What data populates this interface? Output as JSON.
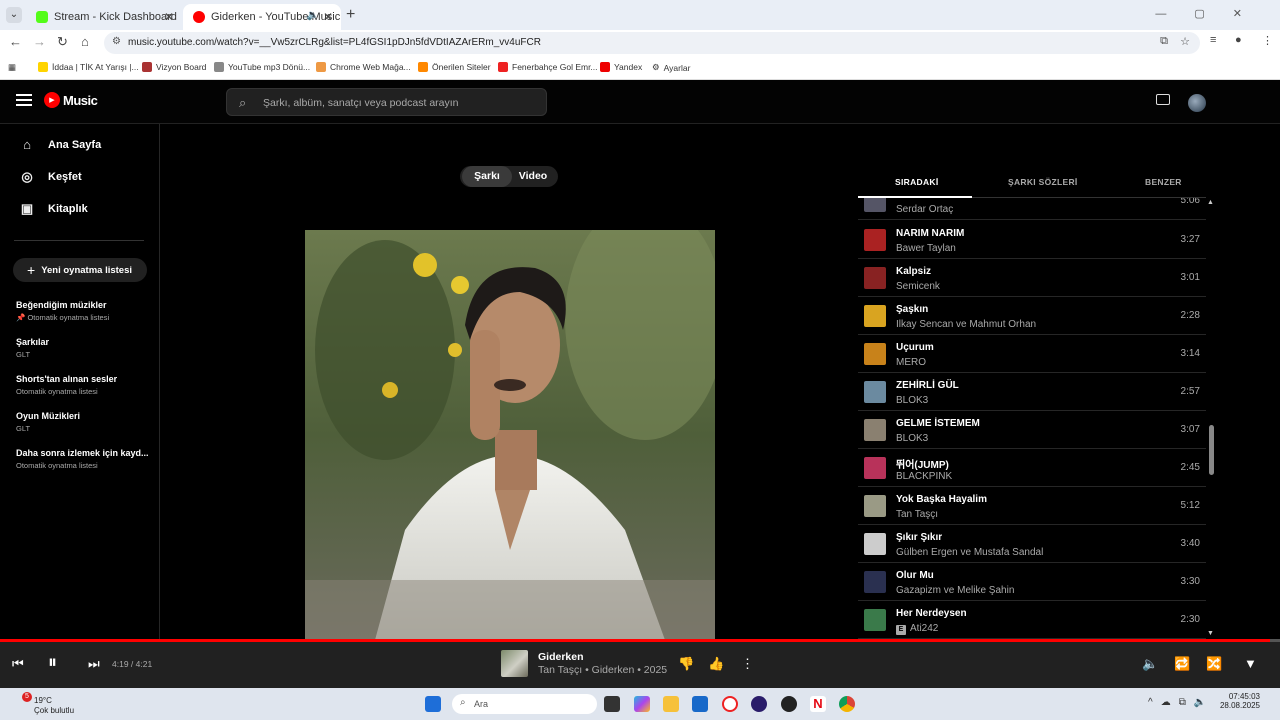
{
  "browser": {
    "tabs": [
      {
        "title": "Stream - Kick Dashboard",
        "color": "#53fc18"
      },
      {
        "title": "Giderken - YouTube Music",
        "color": "#ff0000"
      }
    ],
    "url": "music.youtube.com/watch?v=__Vw5zrCLRg&list=PL4fGSI1pDJn5fdVDtIAZArERm_vv4uFCR",
    "bookmarks": [
      "İddaa | TİK At Yarışı |...",
      "Vizyon Board",
      "YouTube mp3 Dönü...",
      "Chrome Web Mağa...",
      "Önerilen Siteler",
      "Fenerbahçe Gol Emr...",
      "Yandex",
      "Ayarlar"
    ]
  },
  "header": {
    "logo_text": "Music",
    "search_placeholder": "Şarkı, albüm, sanatçı veya podcast arayın"
  },
  "sidebar": {
    "nav": [
      {
        "label": "Ana Sayfa",
        "icon": "home-icon"
      },
      {
        "label": "Keşfet",
        "icon": "compass-icon"
      },
      {
        "label": "Kitaplık",
        "icon": "library-icon"
      }
    ],
    "new_playlist": "Yeni oynatma listesi",
    "playlists": [
      {
        "title": "Beğendiğim müzikler",
        "subtitle": "Otomatik oynatma listesi",
        "pinned": true
      },
      {
        "title": "Şarkılar",
        "subtitle": "GLT"
      },
      {
        "title": "Shorts'tan alınan sesler",
        "subtitle": "Otomatik oynatma listesi"
      },
      {
        "title": "Oyun Müzikleri",
        "subtitle": "GLT"
      },
      {
        "title": "Daha sonra izlemek için kayd...",
        "subtitle": "Otomatik oynatma listesi"
      }
    ]
  },
  "player_toggle": {
    "song": "Şarkı",
    "video": "Video"
  },
  "queue_tabs": [
    "SIRADAKİ",
    "ŞARKI SÖZLERİ",
    "BENZER"
  ],
  "queue": [
    {
      "title": "",
      "artist": "Serdar Ortaç",
      "duration": "5:06",
      "thumb": "#556"
    },
    {
      "title": "NARIM NARIM",
      "artist": "Bawer Taylan",
      "duration": "3:27",
      "thumb": "#a22"
    },
    {
      "title": "Kalpsiz",
      "artist": "Semicenk",
      "duration": "3:01",
      "thumb": "#822"
    },
    {
      "title": "Şaşkın",
      "artist": "Ilkay Sencan ve Mahmut Orhan",
      "duration": "2:28",
      "thumb": "#d9a420"
    },
    {
      "title": "Uçurum",
      "artist": "MERO",
      "duration": "3:14",
      "thumb": "#c8821a"
    },
    {
      "title": "ZEHİRLİ GÜL",
      "artist": "BLOK3",
      "duration": "2:57",
      "thumb": "#6b8aa0"
    },
    {
      "title": "GELME İSTEMEM",
      "artist": "BLOK3",
      "duration": "3:07",
      "thumb": "#8a8070"
    },
    {
      "title": "뛰어(JUMP)",
      "artist": "BLACKPINK",
      "duration": "2:45",
      "thumb": "#b8325a"
    },
    {
      "title": "Yok Başka Hayalim",
      "artist": "Tan Taşçı",
      "duration": "5:12",
      "thumb": "#9a9a85"
    },
    {
      "title": "Şıkır Şıkır",
      "artist": "Gülben Ergen ve Mustafa Sandal",
      "duration": "3:40",
      "thumb": "#ccc"
    },
    {
      "title": "Olur Mu",
      "artist": "Gazapizm ve Melike Şahin",
      "duration": "3:30",
      "thumb": "#2a3050"
    },
    {
      "title": "Her Nerdeysen",
      "artist": "Ati242",
      "duration": "2:30",
      "thumb": "#3a7a4a",
      "explicit": "E"
    }
  ],
  "now_playing": {
    "title": "Giderken",
    "subtitle": "Tan Taşçı • Giderken • 2025",
    "time": "4:19 / 4:21",
    "progress": 0.992
  },
  "taskbar": {
    "temp": "19°C",
    "weather": "Çok bulutlu",
    "weather_badge": "5",
    "search_label": "Ara",
    "time": "07:45:03",
    "date": "28.08.2025"
  }
}
